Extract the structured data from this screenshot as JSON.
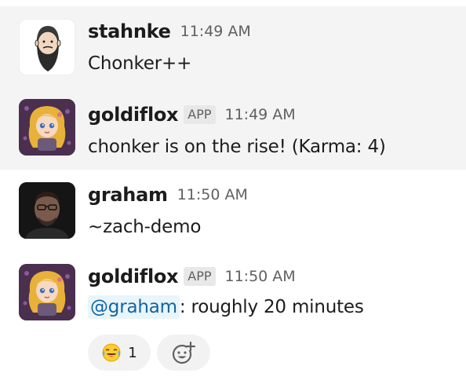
{
  "messages": [
    {
      "author": "stahnke",
      "time": "11:49 AM",
      "text": "Chonker++"
    },
    {
      "author": "goldiflox",
      "badge": "APP",
      "time": "11:49 AM",
      "text": "chonker is on the rise! (Karma: 4)"
    },
    {
      "author": "graham",
      "time": "11:50 AM",
      "text": "~zach-demo"
    },
    {
      "author": "goldiflox",
      "badge": "APP",
      "time": "11:50 AM",
      "mention": "@graham",
      "text": ": roughly 20 minutes"
    }
  ],
  "reactions": [
    {
      "emoji": "joy-emoji",
      "count": "1"
    }
  ],
  "icons": {
    "add_reaction": "add-reaction-icon"
  },
  "colors": {
    "highlight_bg": "#f4f4f5",
    "mention_bg": "#e8f5fa",
    "mention_text": "#1264a3",
    "badge_bg": "#e8e8e8"
  }
}
